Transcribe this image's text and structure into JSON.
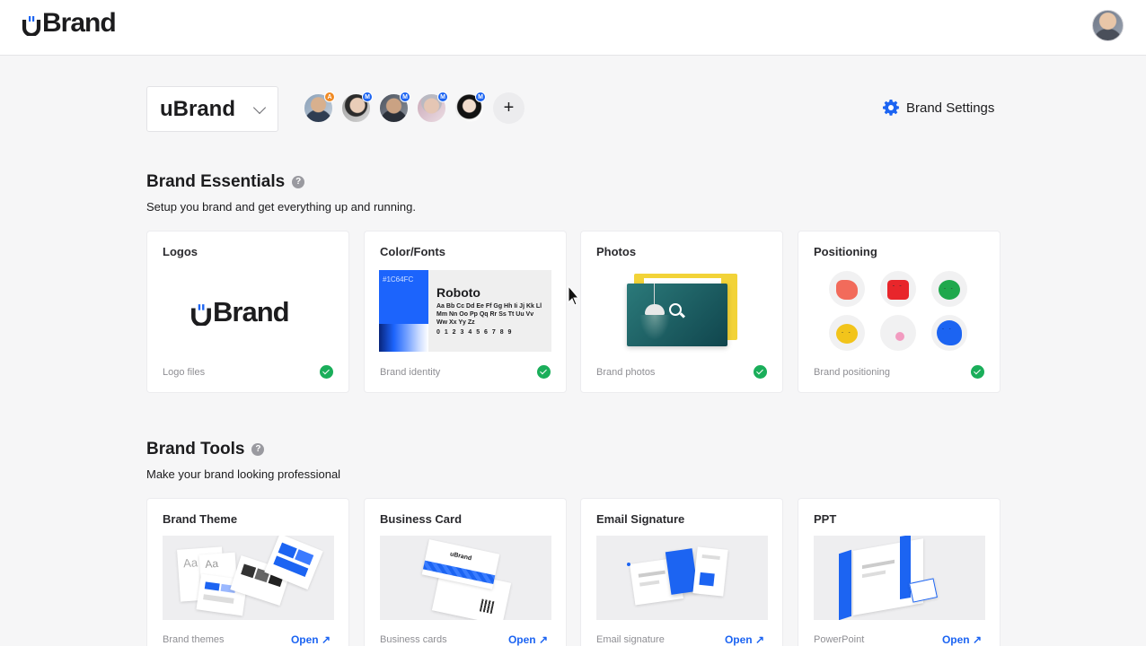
{
  "header": {
    "logo_text": "Brand",
    "profile_icon": "user-avatar"
  },
  "workspace": {
    "brand_name": "uBrand",
    "members": [
      {
        "badge": "A",
        "badge_color": "#f08a24"
      },
      {
        "badge": "M",
        "badge_color": "#1c64f2"
      },
      {
        "badge": "M",
        "badge_color": "#1c64f2"
      },
      {
        "badge": "M",
        "badge_color": "#1c64f2"
      },
      {
        "badge": "M",
        "badge_color": "#1c64f2"
      }
    ],
    "add_member_label": "+",
    "settings_label": "Brand Settings"
  },
  "essentials": {
    "title": "Brand Essentials",
    "help": "?",
    "subtitle": "Setup you brand and get everything up and running.",
    "cards": [
      {
        "title": "Logos",
        "footer": "Logo files",
        "logo_text": "Brand"
      },
      {
        "title": "Color/Fonts",
        "footer": "Brand identity",
        "hex": "#1C64FC",
        "font_name": "Roboto",
        "glyphs": "Aa Bb Cc Dd Ee Ff Gg Hh Ii Jj Kk Ll Mm Nn Oo Pp Qq Rr Ss Tt Uu Vv Ww Xx Yy Zz",
        "digits": "0 1 2 3 4 5 6 7 8 9"
      },
      {
        "title": "Photos",
        "footer": "Brand photos"
      },
      {
        "title": "Positioning",
        "footer": "Brand positioning"
      }
    ]
  },
  "tools": {
    "title": "Brand Tools",
    "help": "?",
    "subtitle": "Make your brand looking professional",
    "cards": [
      {
        "title": "Brand Theme",
        "footer": "Brand themes",
        "action": "Open ↗"
      },
      {
        "title": "Business Card",
        "footer": "Business cards",
        "action": "Open ↗",
        "card_logo": "uBrand"
      },
      {
        "title": "Email Signature",
        "footer": "Email signature",
        "action": "Open ↗"
      },
      {
        "title": "PPT",
        "footer": "PowerPoint",
        "action": "Open ↗"
      }
    ]
  },
  "colors": {
    "accent": "#1c64f2",
    "success": "#1aae5a"
  }
}
